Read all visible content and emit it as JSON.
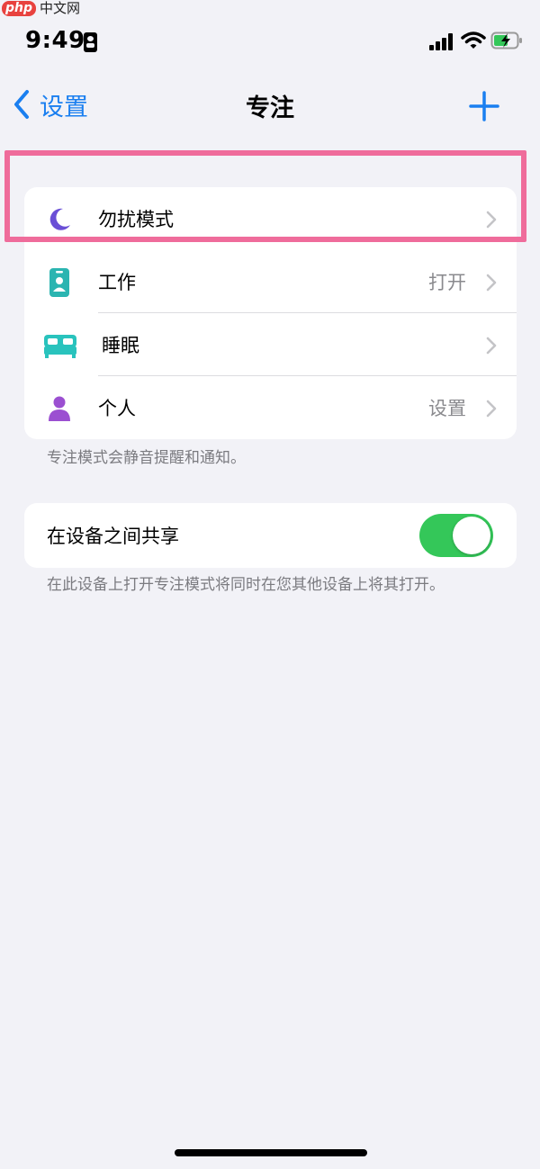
{
  "watermark": {
    "logo": "php",
    "text": "中文网"
  },
  "status_bar": {
    "time": "9:49"
  },
  "nav": {
    "back_label": "设置",
    "title": "专注"
  },
  "focus_modes": [
    {
      "label": "勿扰模式",
      "value": "",
      "icon": "moon-icon"
    },
    {
      "label": "工作",
      "value": "打开",
      "icon": "id-badge-icon"
    },
    {
      "label": "睡眠",
      "value": "",
      "icon": "bed-icon"
    },
    {
      "label": "个人",
      "value": "设置",
      "icon": "person-icon"
    }
  ],
  "focus_footnote": "专注模式会静音提醒和通知。",
  "share": {
    "label": "在设备之间共享",
    "enabled": true,
    "footnote": "在此设备上打开专注模式将同时在您其他设备上将其打开。"
  },
  "colors": {
    "accent": "#1a7ff0",
    "highlight": "#ef6c9b",
    "toggle_on": "#34c759",
    "moon": "#6a4fd6",
    "work": "#2bb5b1",
    "sleep": "#29c3bd",
    "personal": "#9b4fd1"
  }
}
